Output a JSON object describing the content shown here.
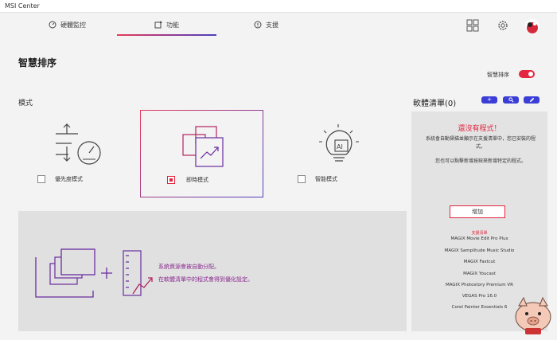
{
  "window": {
    "title": "MSI Center"
  },
  "tabs": [
    {
      "label": "硬體監控",
      "icon": "monitor-gauge-icon"
    },
    {
      "label": "功能",
      "icon": "feature-icon",
      "active": true
    },
    {
      "label": "支援",
      "icon": "support-icon"
    }
  ],
  "header_icons": [
    "grid-icon",
    "gear-icon",
    "avatar"
  ],
  "page": {
    "title": "智慧排序",
    "toggle_label": "智慧排序",
    "toggle_on": true
  },
  "modes": {
    "section_label": "模式",
    "items": [
      {
        "label": "優先度模式",
        "icon": "priority-mode-icon",
        "checked": false
      },
      {
        "label": "即時模式",
        "icon": "realtime-mode-icon",
        "checked": true
      },
      {
        "label": "智能模式",
        "icon": "ai-bulb-icon",
        "checked": false
      }
    ]
  },
  "info": {
    "line1": "系統資源會被自動分配。",
    "line2": "在軟體清單中的程式會得到優化設定。"
  },
  "software": {
    "title": "軟體清單(0)",
    "buttons": [
      {
        "label": "+",
        "icon": "add-icon"
      },
      {
        "label": "",
        "icon": "search-icon"
      },
      {
        "label": "",
        "icon": "edit-icon"
      }
    ],
    "empty_title": "還沒有程式！",
    "empty_desc1": "系統會自動掃描並顯示在支援清單中，您已安裝的程式。",
    "empty_desc2": "您也可以點擊新增按鈕來新增特定的程式。",
    "add_button": "增加",
    "supported_title": "支援清單",
    "supported": [
      "MAGIX Movie Edit Pro Plus",
      "MAGIX Samplitude Music Studio",
      "MAGIX Fastcut",
      "MAGIX Youcast",
      "MAGIX Photostory Premium VR",
      "VEGAS Pro 16.0",
      "Corel Painter Essentials 6"
    ]
  },
  "colors": {
    "accent_red": "#e3253f",
    "accent_blue": "#3b3ed6",
    "accent_purple": "#8a2a8f"
  }
}
